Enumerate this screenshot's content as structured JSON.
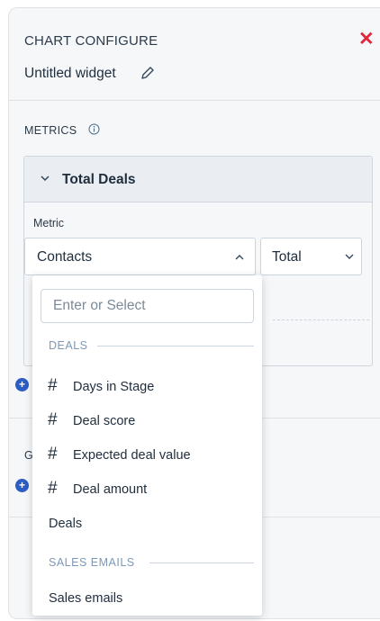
{
  "header": {
    "title": "CHART CONFIGURE",
    "close_icon": "close-icon",
    "widget_name": "Untitled widget",
    "edit_icon": "pencil-icon"
  },
  "metrics": {
    "label": "METRICS",
    "info_icon": "info-icon",
    "card": {
      "title": "Total Deals",
      "metric_label": "Metric",
      "metric_value": "Contacts",
      "aggregation_value": "Total"
    }
  },
  "group_by": {
    "label_fragment": "G"
  },
  "dropdown": {
    "search_placeholder": "Enter or Select",
    "groups": [
      {
        "label": "DEALS",
        "items": [
          {
            "label": "Days in Stage",
            "icon": "#"
          },
          {
            "label": "Deal score",
            "icon": "#"
          },
          {
            "label": "Expected deal value",
            "icon": "#"
          },
          {
            "label": "Deal amount",
            "icon": "#"
          },
          {
            "label": "Deals",
            "icon": ""
          }
        ]
      },
      {
        "label": "SALES EMAILS",
        "items": [
          {
            "label": "Sales emails",
            "icon": ""
          }
        ]
      }
    ]
  },
  "colors": {
    "accent": "#2c5cc5",
    "close": "#e0263a",
    "panel_bg": "#f5f7f9"
  }
}
